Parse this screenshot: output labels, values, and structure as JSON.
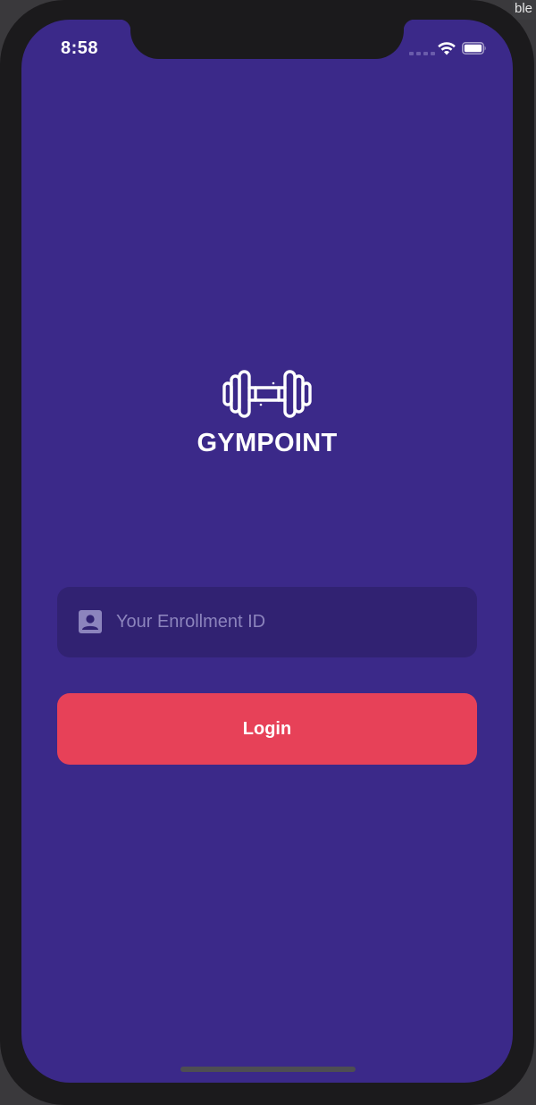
{
  "status_bar": {
    "time": "8:58"
  },
  "app": {
    "brand": "GYMPOINT",
    "logo_icon": "dumbbell-icon"
  },
  "login_form": {
    "enrollment_field": {
      "icon": "account-box-icon",
      "placeholder": "Your Enrollment ID",
      "value": ""
    },
    "login_button_label": "Login"
  },
  "desktop": {
    "corner_text": "ble",
    "corner_dots": ".."
  },
  "colors": {
    "screen_background": "#3b2989",
    "field_background": "#312272",
    "placeholder_text": "#8c84bd",
    "login_button": "#e74158",
    "text": "#ffffff"
  }
}
